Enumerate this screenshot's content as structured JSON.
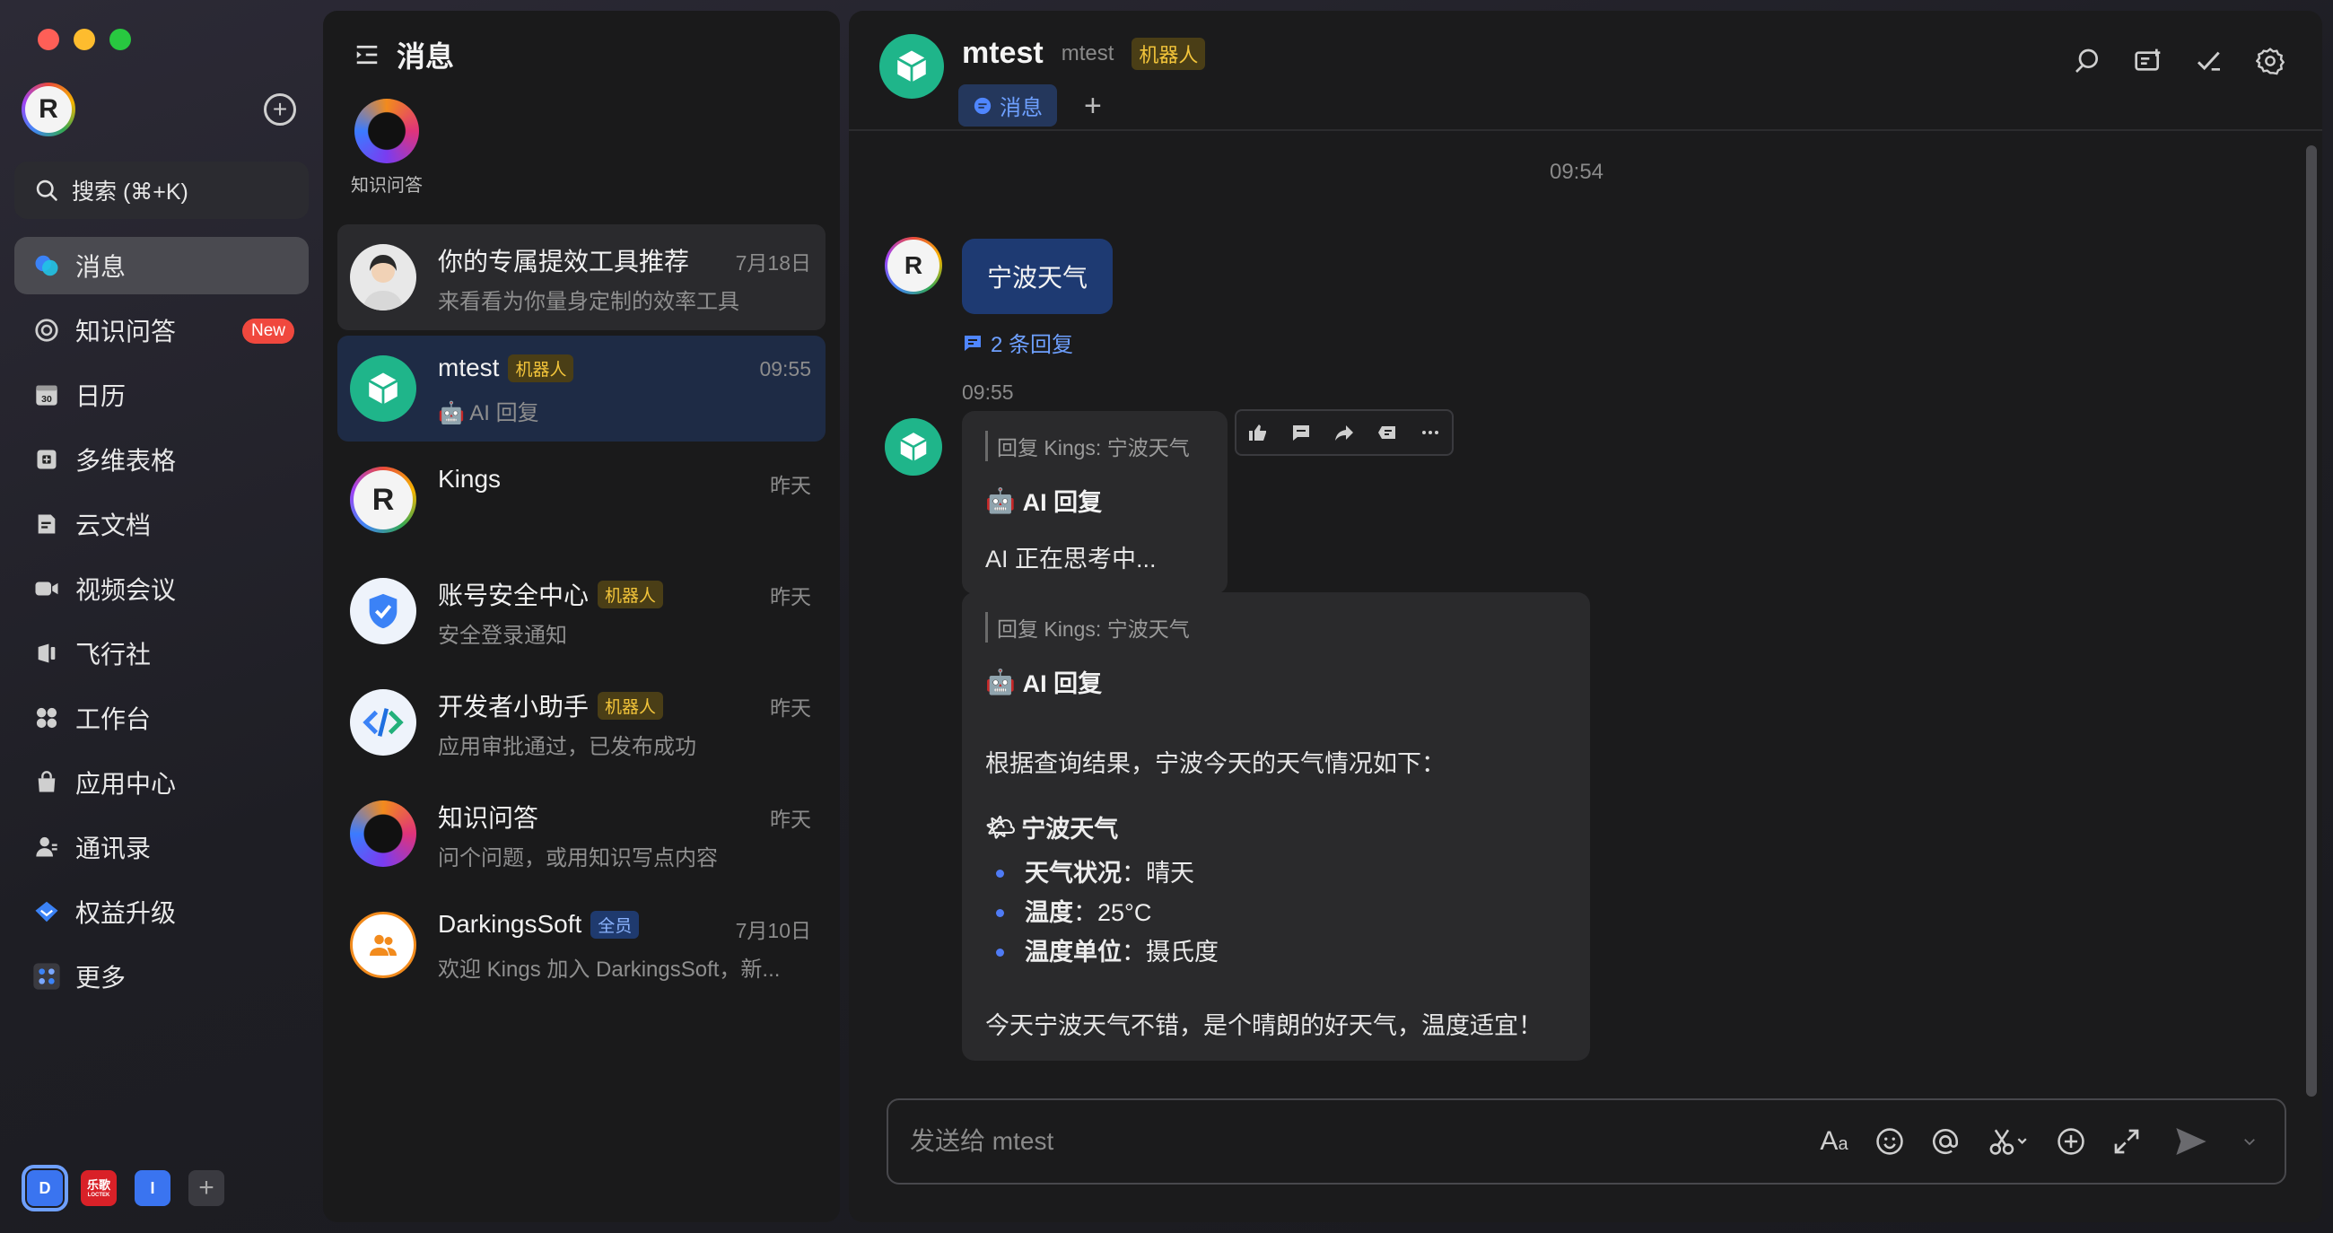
{
  "nav": {
    "search_label": "搜索 (⌘+K)",
    "items": [
      {
        "label": "消息",
        "icon": "message-icon",
        "active": true
      },
      {
        "label": "知识问答",
        "icon": "knowledge-icon",
        "badge": "New"
      },
      {
        "label": "日历",
        "icon": "calendar-icon",
        "day": "30"
      },
      {
        "label": "多维表格",
        "icon": "table-icon"
      },
      {
        "label": "云文档",
        "icon": "doc-icon"
      },
      {
        "label": "视频会议",
        "icon": "video-icon"
      },
      {
        "label": "飞行社",
        "icon": "community-icon"
      },
      {
        "label": "工作台",
        "icon": "workbench-icon"
      },
      {
        "label": "应用中心",
        "icon": "app-center-icon"
      },
      {
        "label": "通讯录",
        "icon": "contacts-icon"
      },
      {
        "label": "权益升级",
        "icon": "upgrade-icon"
      },
      {
        "label": "更多",
        "icon": "more-apps-icon"
      }
    ],
    "workspaces": [
      {
        "label": "D"
      },
      {
        "label": "乐歌",
        "sub": "LOCTEK"
      },
      {
        "label": "I"
      }
    ]
  },
  "conversations": {
    "title": "消息",
    "pinned_label": "知识问答",
    "items": [
      {
        "name": "你的专属提效工具推荐",
        "time": "7月18日",
        "preview": "来看看为你量身定制的效率工具"
      },
      {
        "name": "mtest",
        "tag": "机器人",
        "time": "09:55",
        "preview": "AI 回复"
      },
      {
        "name": "Kings",
        "time": "昨天",
        "preview": ""
      },
      {
        "name": "账号安全中心",
        "tag": "机器人",
        "time": "昨天",
        "preview": "安全登录通知"
      },
      {
        "name": "开发者小助手",
        "tag": "机器人",
        "time": "昨天",
        "preview": "应用审批通过，已发布成功"
      },
      {
        "name": "知识问答",
        "time": "昨天",
        "preview": "问个问题，或用知识写点内容"
      },
      {
        "name": "DarkingsSoft",
        "tag": "全员",
        "time": "7月10日",
        "preview": "欢迎 Kings 加入 DarkingsSoft，新..."
      }
    ]
  },
  "chat": {
    "name": "mtest",
    "subname": "mtest",
    "tag": "机器人",
    "tab_label": "消息",
    "timestamp1": "09:54",
    "user_message": "宁波天气",
    "reply_count": "2 条回复",
    "timestamp2": "09:55",
    "reply1": {
      "quote": "回复 Kings: 宁波天气",
      "title": "AI 回复",
      "body": "AI 正在思考中..."
    },
    "reply2": {
      "quote": "回复 Kings: 宁波天气",
      "title": "AI 回复",
      "intro": "根据查询结果，宁波今天的天气情况如下：",
      "weather_title": "宁波天气",
      "items": [
        {
          "key": "天气状况",
          "value": "：晴天"
        },
        {
          "key": "温度",
          "value": "：25°C"
        },
        {
          "key": "温度单位",
          "value": "：摄氏度"
        }
      ],
      "summary": "今天宁波天气不错，是个晴朗的好天气，温度适宜！"
    },
    "input_placeholder": "发送给 mtest"
  }
}
